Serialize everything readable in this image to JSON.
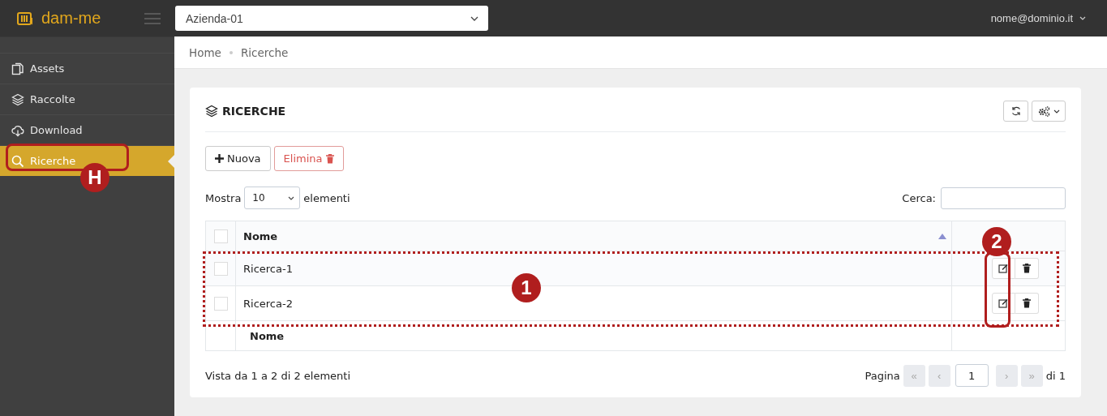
{
  "topbar": {
    "logo": "dam-me",
    "company_select": {
      "value": "Azienda-01"
    },
    "user_menu": "nome@dominio.it"
  },
  "sidebar": {
    "items": [
      {
        "label": "Assets",
        "selected": false
      },
      {
        "label": "Raccolte",
        "selected": false
      },
      {
        "label": "Download",
        "selected": false
      },
      {
        "label": "Ricerche",
        "selected": true
      }
    ]
  },
  "breadcrumb": [
    "Home",
    "Ricerche"
  ],
  "card": {
    "title": "RICERCHE",
    "buttons": [
      {
        "label": "Nuova",
        "kind": "primary"
      },
      {
        "label": "Elimina",
        "kind": "danger"
      }
    ],
    "length": {
      "prefix": "Mostra",
      "value": "10",
      "suffix": "elementi"
    },
    "search": {
      "label": "Cerca:"
    },
    "table": {
      "select_all": {
        "checked": false
      },
      "columns": [
        {
          "label": "Nome",
          "sorted": true
        }
      ],
      "rows": [
        {
          "name": "Ricerca-1",
          "checked": false
        },
        {
          "name": "Ricerca-2",
          "checked": false
        }
      ],
      "footer": [
        "Nome"
      ]
    },
    "info": "Vista da 1 a 2 di 2 elementi",
    "pagination": {
      "label": "Pagina",
      "page": "1",
      "first": "«",
      "prev": "‹",
      "next": "›",
      "last": "»",
      "total": "di 1"
    }
  },
  "annotations": [
    {
      "kind": "outline"
    },
    {
      "kind": "badge",
      "label": "H"
    },
    {
      "kind": "dotted"
    },
    {
      "kind": "badge",
      "label": "1"
    },
    {
      "kind": "outline"
    },
    {
      "kind": "badge",
      "label": "2"
    }
  ]
}
